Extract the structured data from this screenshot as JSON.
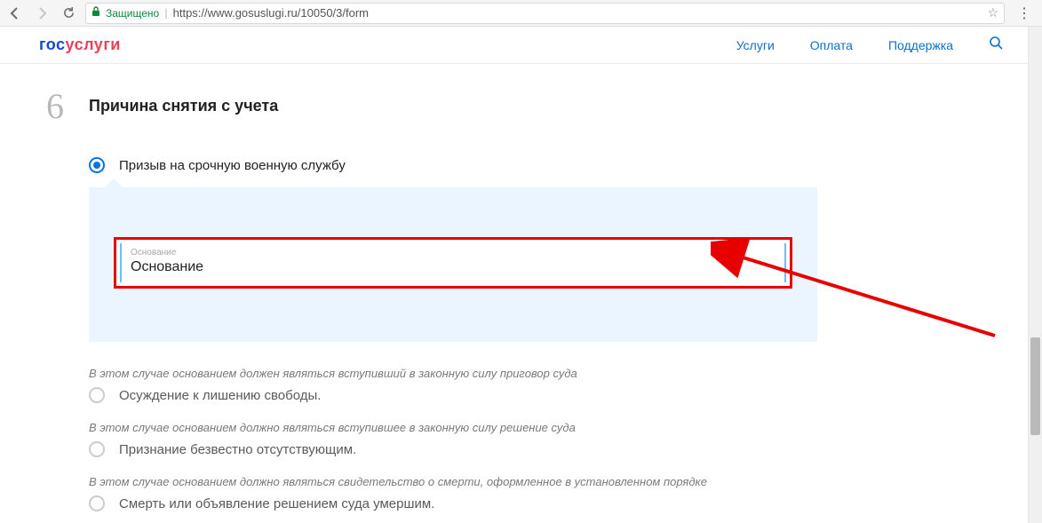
{
  "browser": {
    "secure_label": "Защищено",
    "url": "https://www.gosuslugi.ru/10050/3/form"
  },
  "header": {
    "logo_blue": "гос",
    "logo_red": "услуги",
    "nav": {
      "services": "Услуги",
      "payment": "Оплата",
      "support": "Поддержка"
    }
  },
  "step": {
    "number": "6",
    "title": "Причина снятия с учета"
  },
  "options": {
    "opt1": {
      "label": "Призыв на срочную военную службу",
      "selected": true
    },
    "opt2": {
      "note": "В этом случае основанием должен являться вступивший в законную силу приговор суда",
      "label": "Осуждение к лишению свободы."
    },
    "opt3": {
      "note": "В этом случае основанием должно являться вступившее в законную силу решение суда",
      "label": "Признание безвестно отсутствующим."
    },
    "opt4": {
      "note": "В этом случае основанием должно являться свидетельство о смерти, оформленное в установленном порядке",
      "label": "Смерть или объявление решением суда умершим."
    }
  },
  "field": {
    "tiny_label": "Основание",
    "value": "Основание"
  }
}
